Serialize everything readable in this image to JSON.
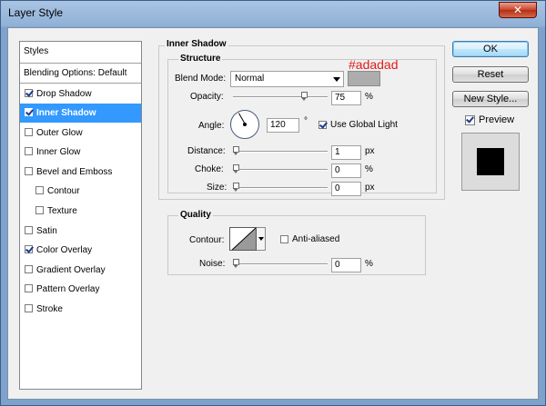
{
  "window": {
    "title": "Layer Style",
    "close_glyph": "✕"
  },
  "sidebar": {
    "styles_header": "Styles",
    "blending_options": "Blending Options: Default",
    "items": [
      {
        "label": "Drop Shadow",
        "checked": true
      },
      {
        "label": "Inner Shadow",
        "checked": true,
        "selected": true
      },
      {
        "label": "Outer Glow",
        "checked": false
      },
      {
        "label": "Inner Glow",
        "checked": false
      },
      {
        "label": "Bevel and Emboss",
        "checked": false
      },
      {
        "label": "Contour",
        "checked": false,
        "sub": true
      },
      {
        "label": "Texture",
        "checked": false,
        "sub": true
      },
      {
        "label": "Satin",
        "checked": false
      },
      {
        "label": "Color Overlay",
        "checked": true
      },
      {
        "label": "Gradient Overlay",
        "checked": false
      },
      {
        "label": "Pattern Overlay",
        "checked": false
      },
      {
        "label": "Stroke",
        "checked": false
      }
    ]
  },
  "inner_shadow": {
    "section_title": "Inner Shadow",
    "structure": {
      "title": "Structure",
      "blend_mode_label": "Blend Mode:",
      "blend_mode_value": "Normal",
      "color_swatch": "#adadad",
      "color_note": "#adadad",
      "opacity_label": "Opacity:",
      "opacity_value": "75",
      "opacity_unit": "%",
      "opacity_fraction": 0.75,
      "angle_label": "Angle:",
      "angle_value": "120",
      "angle_unit": "°",
      "use_global_light_label": "Use Global Light",
      "use_global_light_checked": true,
      "distance_label": "Distance:",
      "distance_value": "1",
      "distance_unit": "px",
      "choke_label": "Choke:",
      "choke_value": "0",
      "choke_unit": "%",
      "size_label": "Size:",
      "size_value": "0",
      "size_unit": "px"
    },
    "quality": {
      "title": "Quality",
      "contour_label": "Contour:",
      "anti_aliased_label": "Anti-aliased",
      "anti_aliased_checked": false,
      "noise_label": "Noise:",
      "noise_value": "0",
      "noise_unit": "%"
    }
  },
  "actions": {
    "ok_label": "OK",
    "reset_label": "Reset",
    "new_style_label": "New Style...",
    "preview_label": "Preview",
    "preview_checked": true
  }
}
